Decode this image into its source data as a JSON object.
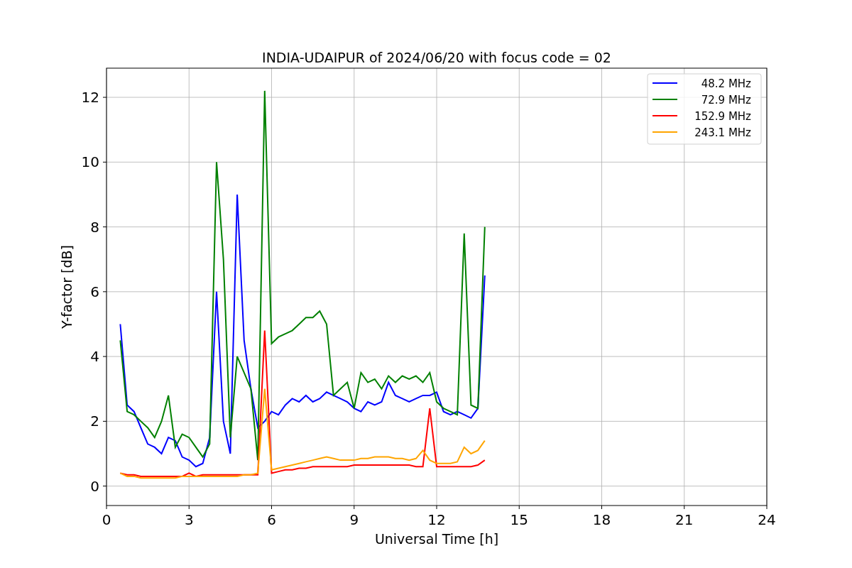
{
  "chart_data": {
    "type": "line",
    "title": "INDIA-UDAIPUR of 2024/06/20 with focus code = 02",
    "xlabel": "Universal Time [h]",
    "ylabel": "Y-factor [dB]",
    "x": [
      0.5,
      0.75,
      1.0,
      1.25,
      1.5,
      1.75,
      2.0,
      2.25,
      2.5,
      2.75,
      3.0,
      3.25,
      3.5,
      3.75,
      4.0,
      4.25,
      4.5,
      4.75,
      5.0,
      5.25,
      5.5,
      5.75,
      6.0,
      6.25,
      6.5,
      6.75,
      7.0,
      7.25,
      7.5,
      7.75,
      8.0,
      8.25,
      8.5,
      8.75,
      9.0,
      9.25,
      9.5,
      9.75,
      10.0,
      10.25,
      10.5,
      10.75,
      11.0,
      11.25,
      11.5,
      11.75,
      12.0,
      12.25,
      12.5,
      12.75,
      13.0,
      13.25,
      13.5,
      13.75
    ],
    "series": [
      {
        "name": "48.2 MHz",
        "color": "#0000ff",
        "values": [
          5.0,
          2.5,
          2.3,
          1.8,
          1.3,
          1.2,
          1.0,
          1.5,
          1.4,
          0.9,
          0.8,
          0.6,
          0.7,
          1.5,
          6.0,
          2.0,
          1.0,
          9.0,
          4.5,
          3.0,
          1.8,
          2.0,
          2.3,
          2.2,
          2.5,
          2.7,
          2.6,
          2.8,
          2.6,
          2.7,
          2.9,
          2.8,
          2.7,
          2.6,
          2.4,
          2.3,
          2.6,
          2.5,
          2.6,
          3.2,
          2.8,
          2.7,
          2.6,
          2.7,
          2.8,
          2.8,
          2.9,
          2.3,
          2.2,
          2.3,
          2.2,
          2.1,
          2.4,
          6.5
        ]
      },
      {
        "name": "72.9 MHz",
        "color": "#008000",
        "values": [
          4.5,
          2.3,
          2.2,
          2.0,
          1.8,
          1.5,
          2.0,
          2.8,
          1.2,
          1.6,
          1.5,
          1.2,
          0.9,
          1.3,
          10.0,
          7.0,
          1.5,
          4.0,
          3.5,
          3.0,
          0.8,
          12.2,
          4.4,
          4.6,
          4.7,
          4.8,
          5.0,
          5.2,
          5.2,
          5.4,
          5.0,
          2.8,
          3.0,
          3.2,
          2.4,
          3.5,
          3.2,
          3.3,
          3.0,
          3.4,
          3.2,
          3.4,
          3.3,
          3.4,
          3.2,
          3.5,
          2.6,
          2.4,
          2.3,
          2.2,
          7.8,
          2.5,
          2.4,
          8.0
        ]
      },
      {
        "name": "152.9 MHz",
        "color": "#ff0000",
        "values": [
          0.4,
          0.35,
          0.35,
          0.3,
          0.3,
          0.3,
          0.3,
          0.3,
          0.3,
          0.3,
          0.4,
          0.3,
          0.35,
          0.35,
          0.35,
          0.35,
          0.35,
          0.35,
          0.35,
          0.35,
          0.35,
          4.8,
          0.4,
          0.45,
          0.5,
          0.5,
          0.55,
          0.55,
          0.6,
          0.6,
          0.6,
          0.6,
          0.6,
          0.6,
          0.65,
          0.65,
          0.65,
          0.65,
          0.65,
          0.65,
          0.65,
          0.65,
          0.65,
          0.6,
          0.6,
          2.4,
          0.6,
          0.6,
          0.6,
          0.6,
          0.6,
          0.6,
          0.65,
          0.8
        ]
      },
      {
        "name": "243.1 MHz",
        "color": "#ffa500",
        "values": [
          0.4,
          0.3,
          0.3,
          0.25,
          0.25,
          0.25,
          0.25,
          0.25,
          0.25,
          0.3,
          0.3,
          0.3,
          0.3,
          0.3,
          0.3,
          0.3,
          0.3,
          0.3,
          0.35,
          0.35,
          0.4,
          3.0,
          0.5,
          0.55,
          0.6,
          0.65,
          0.7,
          0.75,
          0.8,
          0.85,
          0.9,
          0.85,
          0.8,
          0.8,
          0.8,
          0.85,
          0.85,
          0.9,
          0.9,
          0.9,
          0.85,
          0.85,
          0.8,
          0.85,
          1.1,
          0.8,
          0.7,
          0.7,
          0.7,
          0.75,
          1.2,
          1.0,
          1.1,
          1.4
        ]
      }
    ],
    "grid": true,
    "legend": true,
    "xlim": [
      0,
      24
    ],
    "ylim": [
      -0.6,
      12.9
    ],
    "xticks": [
      0,
      3,
      6,
      9,
      12,
      15,
      18,
      21,
      24
    ],
    "yticks": [
      0,
      2,
      4,
      6,
      8,
      10,
      12
    ]
  }
}
